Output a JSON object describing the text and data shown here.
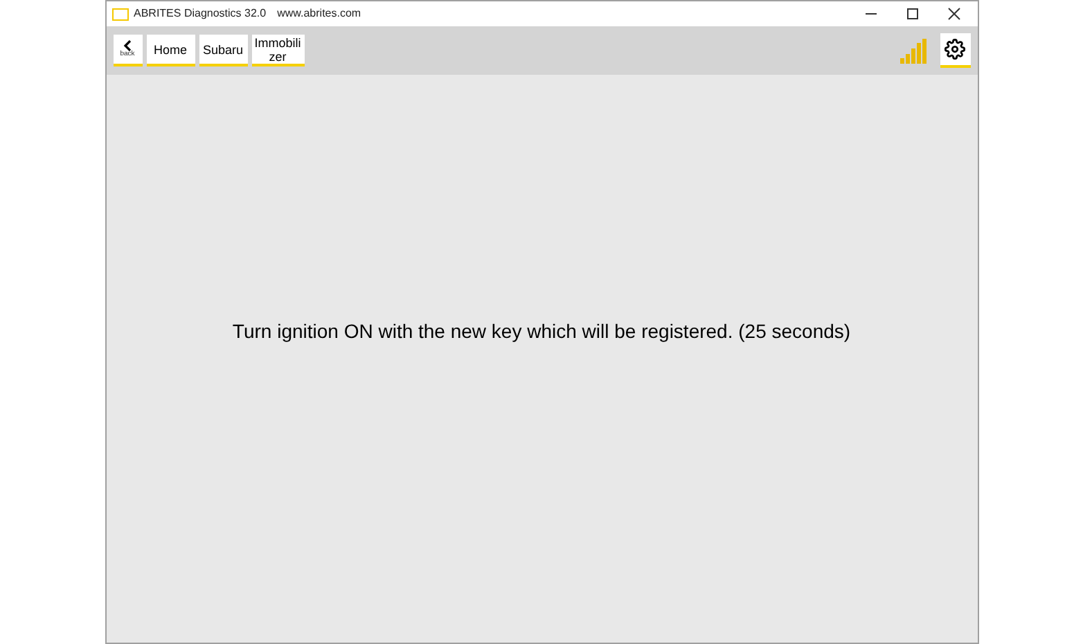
{
  "window": {
    "title": "ABRITES Diagnostics 32.0",
    "url": "www.abrites.com"
  },
  "toolbar": {
    "back_label": "back",
    "breadcrumbs": [
      {
        "label": "Home"
      },
      {
        "label": "Subaru"
      },
      {
        "label": "Immobilizer"
      }
    ]
  },
  "message": "Turn ignition ON with the new key which will be registered. (25 seconds)"
}
